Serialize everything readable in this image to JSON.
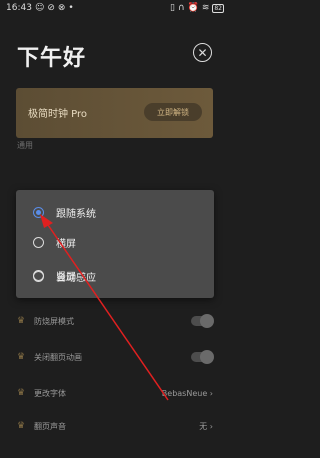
{
  "status_bar": {
    "time": "16:43",
    "battery": "82"
  },
  "header": {
    "greeting": "下午好"
  },
  "pro_banner": {
    "title": "极简时钟 Pro",
    "button_label": "立即解锁"
  },
  "section": {
    "label": "通用"
  },
  "orientation_dialog": {
    "options": [
      {
        "label": "跟随系统",
        "selected": true
      },
      {
        "label": "横屏",
        "selected": false
      },
      {
        "label": "竖屏",
        "selected": false
      },
      {
        "label": "自动感应",
        "selected": false
      }
    ]
  },
  "settings": {
    "anti_burn": {
      "label": "防烧屏模式"
    },
    "flip_anim": {
      "label": "关闭翻页动画"
    },
    "font": {
      "label": "更改字体",
      "value": "BebasNeue"
    },
    "flip_sound": {
      "label": "翻页声音",
      "value": "无"
    }
  },
  "colors": {
    "accent": "#5a8de8",
    "pro_gold": "#6d5a3b",
    "arrow": "#e02020"
  }
}
